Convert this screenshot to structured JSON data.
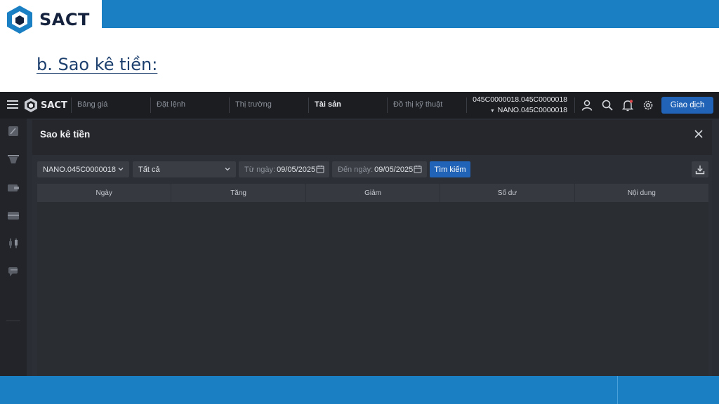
{
  "slide": {
    "logo_text": "SACT",
    "heading": "b. Sao kê tiền:"
  },
  "app": {
    "logo_text": "SACT",
    "nav": [
      "Bảng giá",
      "Đặt lệnh",
      "Thị trường",
      "Tài sản",
      "Đồ thị kỹ thuật"
    ],
    "active_nav": "Tài sản",
    "account_line1": "045C0000018.045C0000018",
    "account_line2": "NANO.045C0000018",
    "trade_button": "Giao dịch",
    "icons": [
      "menu-icon",
      "user-icon",
      "search-icon",
      "bell-icon",
      "gear-icon"
    ],
    "side_icons": [
      "pencil-icon",
      "basket-icon",
      "wallet-icon",
      "box-icon",
      "candlestick-icon",
      "chat-icon"
    ],
    "accent": "#2163b6"
  },
  "panel": {
    "title": "Sao kê tiền",
    "account_select": "NANO.045C0000018",
    "type_select": "Tất cả",
    "from_label": "Từ ngày:",
    "from_date": "09/05/2025",
    "to_label": "Đến ngày:",
    "to_date": "09/05/2025",
    "search_button": "Tìm kiếm",
    "columns": [
      "Ngày",
      "Tăng",
      "Giảm",
      "Số dư",
      "Nội dung"
    ]
  },
  "colors": {
    "slide_bar": "#1b80c3",
    "heading": "#1c3f6e"
  }
}
